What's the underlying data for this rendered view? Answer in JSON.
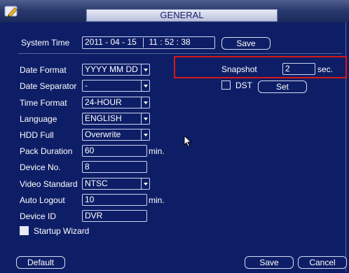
{
  "window": {
    "title": "GENERAL"
  },
  "system_time": {
    "label": "System Time",
    "date": "2011 - 04 - 15",
    "time": "11 : 52 : 38",
    "save_label": "Save"
  },
  "fields": {
    "date_format": {
      "label": "Date Format",
      "value": "YYYY MM DD"
    },
    "date_separator": {
      "label": "Date Separator",
      "value": "-"
    },
    "time_format": {
      "label": "Time Format",
      "value": "24-HOUR"
    },
    "language": {
      "label": "Language",
      "value": "ENGLISH"
    },
    "hdd_full": {
      "label": "HDD Full",
      "value": "Overwrite"
    },
    "pack_duration": {
      "label": "Pack Duration",
      "value": "60",
      "unit": "min."
    },
    "device_no": {
      "label": "Device No.",
      "value": "8"
    },
    "video_standard": {
      "label": "Video Standard",
      "value": "NTSC"
    },
    "auto_logout": {
      "label": "Auto Logout",
      "value": "10",
      "unit": "min."
    },
    "device_id": {
      "label": "Device ID",
      "value": "DVR"
    }
  },
  "snapshot": {
    "label": "Snapshot",
    "value": "2",
    "unit": "sec."
  },
  "dst": {
    "label": "DST",
    "checked": false,
    "set_label": "Set"
  },
  "startup_wizard": {
    "label": "Startup Wizard",
    "checked": true
  },
  "footer": {
    "default_label": "Default",
    "save_label": "Save",
    "cancel_label": "Cancel"
  },
  "colors": {
    "background": "#0e1e66",
    "highlight": "#d61818",
    "text": "#ffffff"
  }
}
